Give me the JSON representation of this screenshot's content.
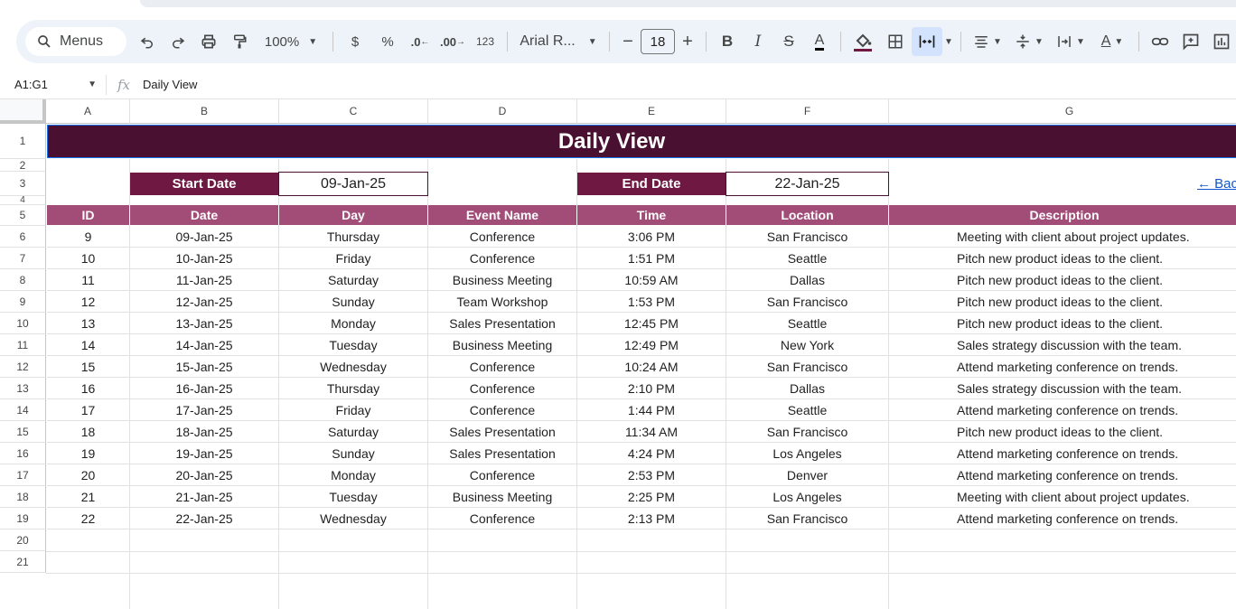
{
  "toolbar": {
    "menus_label": "Menus",
    "zoom": "100%",
    "currency": "$",
    "percent": "%",
    "decrease_decimals": ".0",
    "increase_decimals": ".00",
    "number_format": "123",
    "font_name": "Arial R...",
    "font_size": "18",
    "minus": "−",
    "plus": "+",
    "bold": "B",
    "italic": "I",
    "strike": "S",
    "text_color": "A"
  },
  "formula_bar": {
    "name_box": "A1:G1",
    "fx": "fx",
    "value": "Daily View"
  },
  "columns": [
    "A",
    "B",
    "C",
    "D",
    "E",
    "F",
    "G"
  ],
  "rows": [
    "1",
    "2",
    "3",
    "4",
    "5",
    "6",
    "7",
    "8",
    "9",
    "10",
    "11",
    "12",
    "13",
    "14",
    "15",
    "16",
    "17",
    "18",
    "19",
    "20",
    "21"
  ],
  "sheet": {
    "title": "Daily View",
    "start_label": "Start Date",
    "start_value": "09-Jan-25",
    "end_label": "End Date",
    "end_value": "22-Jan-25",
    "back_link": "← Bac",
    "headers": [
      "ID",
      "Date",
      "Day",
      "Event Name",
      "Time",
      "Location",
      "Description"
    ],
    "records": [
      [
        "9",
        "09-Jan-25",
        "Thursday",
        "Conference",
        "3:06 PM",
        "San Francisco",
        "Meeting with client about project updates."
      ],
      [
        "10",
        "10-Jan-25",
        "Friday",
        "Conference",
        "1:51 PM",
        "Seattle",
        "Pitch new product ideas to the client."
      ],
      [
        "11",
        "11-Jan-25",
        "Saturday",
        "Business Meeting",
        "10:59 AM",
        "Dallas",
        "Pitch new product ideas to the client."
      ],
      [
        "12",
        "12-Jan-25",
        "Sunday",
        "Team Workshop",
        "1:53 PM",
        "San Francisco",
        "Pitch new product ideas to the client."
      ],
      [
        "13",
        "13-Jan-25",
        "Monday",
        "Sales Presentation",
        "12:45 PM",
        "Seattle",
        "Pitch new product ideas to the client."
      ],
      [
        "14",
        "14-Jan-25",
        "Tuesday",
        "Business Meeting",
        "12:49 PM",
        "New York",
        "Sales strategy discussion with the team."
      ],
      [
        "15",
        "15-Jan-25",
        "Wednesday",
        "Conference",
        "10:24 AM",
        "San Francisco",
        "Attend marketing conference on trends."
      ],
      [
        "16",
        "16-Jan-25",
        "Thursday",
        "Conference",
        "2:10 PM",
        "Dallas",
        "Sales strategy discussion with the team."
      ],
      [
        "17",
        "17-Jan-25",
        "Friday",
        "Conference",
        "1:44 PM",
        "Seattle",
        "Attend marketing conference on trends."
      ],
      [
        "18",
        "18-Jan-25",
        "Saturday",
        "Sales Presentation",
        "11:34 AM",
        "San Francisco",
        "Pitch new product ideas to the client."
      ],
      [
        "19",
        "19-Jan-25",
        "Sunday",
        "Sales Presentation",
        "4:24 PM",
        "Los Angeles",
        "Attend marketing conference on trends."
      ],
      [
        "20",
        "20-Jan-25",
        "Monday",
        "Conference",
        "2:53 PM",
        "Denver",
        "Attend marketing conference on trends."
      ],
      [
        "21",
        "21-Jan-25",
        "Tuesday",
        "Business Meeting",
        "2:25 PM",
        "Los Angeles",
        "Meeting with client about project updates."
      ],
      [
        "22",
        "22-Jan-25",
        "Wednesday",
        "Conference",
        "2:13 PM",
        "San Francisco",
        "Attend marketing conference on trends."
      ]
    ]
  },
  "colors": {
    "title_bg": "#4a1031",
    "label_bg": "#6f1842",
    "header_bg": "#a24d78",
    "link": "#1155cc"
  }
}
